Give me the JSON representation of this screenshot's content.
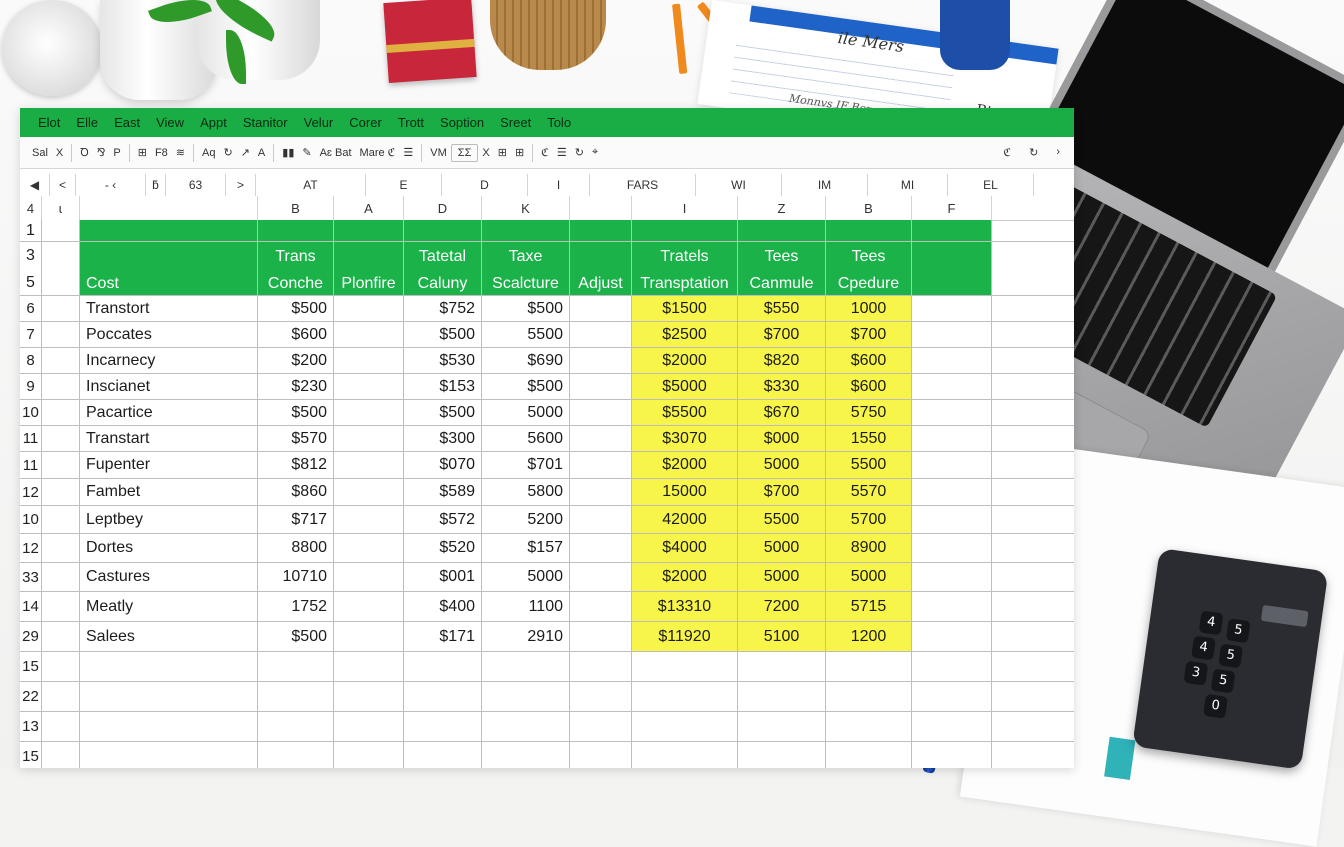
{
  "scene": {
    "paper_title": "ile Mers",
    "paper_sub": "Rtatel",
    "paper_note": "Monnvs IF Bcz"
  },
  "menu": [
    "Elot",
    "Elle",
    "East",
    "View",
    "Appt",
    "Stanitor",
    "Velur",
    "Corer",
    "Trott",
    "Soption",
    "Sreet",
    "Tolo"
  ],
  "toolbar": {
    "left": [
      "Sal",
      "X",
      "Ꝺ",
      "⅋",
      "P",
      "⊞",
      "F8",
      "≋",
      "Aq",
      "↻",
      "↗",
      "A",
      "▮▮",
      "✎",
      "Aɛ  Bat",
      "Mare  ℭ",
      "☰",
      "VM",
      "ƩƩ",
      "X",
      "⊞",
      "⊞",
      "ℭ",
      "☰",
      "↻",
      "⌖"
    ],
    "right": [
      "ℭ",
      "↻",
      "›"
    ]
  },
  "formula_bar": {
    "cells": [
      "◀",
      "<",
      "-  ‹",
      "ƃ",
      "63",
      ">",
      "AT",
      "E",
      "D",
      "I",
      "FARS",
      "WI",
      "IM",
      "MI",
      "EL"
    ]
  },
  "column_letters": [
    "4",
    "ɩ",
    "",
    "B",
    "A",
    "D",
    "K",
    "",
    "I",
    "Z",
    "B",
    "F"
  ],
  "colors": {
    "header_green": "#1bb24a",
    "menu_green": "#1aad46",
    "highlight_yellow": "#f8f54a"
  },
  "header": {
    "row_numbers": [
      "1",
      "3",
      "5"
    ],
    "top": [
      "",
      "",
      "Trans",
      "",
      "Tatetal",
      "Taxe",
      "",
      "Tratels",
      "Tees",
      "Tees",
      ""
    ],
    "bottom": [
      "",
      "Cost",
      "Conche",
      "Plonfire",
      "Caluny",
      "Scalcture",
      "Adjust",
      "Transptation",
      "Canmule",
      "Cpedure",
      ""
    ]
  },
  "rows": [
    {
      "rn": "6",
      "label": "Transtort",
      "c": [
        "$500",
        "",
        "$752",
        "$500",
        "",
        "$1500",
        "$550",
        "1000"
      ]
    },
    {
      "rn": "7",
      "label": "Poccates",
      "c": [
        "$600",
        "",
        "$500",
        "5500",
        "",
        "$2500",
        "$700",
        "$700"
      ]
    },
    {
      "rn": "8",
      "label": "Incarnecy",
      "c": [
        "$200",
        "",
        "$530",
        "$690",
        "",
        "$2000",
        "$820",
        "$600"
      ]
    },
    {
      "rn": "9",
      "label": "Inscianet",
      "c": [
        "$230",
        "",
        "$153",
        "$500",
        "",
        "$5000",
        "$330",
        "$600"
      ]
    },
    {
      "rn": "10",
      "label": "Pacartice",
      "c": [
        "$500",
        "",
        "$500",
        "5000",
        "",
        "$5500",
        "$670",
        "5750"
      ]
    },
    {
      "rn": "11",
      "label": "Transtart",
      "c": [
        "$570",
        "",
        "$300",
        "5600",
        "",
        "$3070",
        "$000",
        "1550"
      ]
    },
    {
      "rn": "11",
      "label": "Fupenter",
      "c": [
        "$812",
        "",
        "$070",
        "$701",
        "",
        "$2000",
        "5000",
        "5500"
      ]
    },
    {
      "rn": "12",
      "label": "Fambet",
      "c": [
        "$860",
        "",
        "$589",
        "5800",
        "",
        "15000",
        "$700",
        "5570"
      ]
    },
    {
      "rn": "10",
      "label": "Leptbey",
      "c": [
        "$717",
        "",
        "$572",
        "5200",
        "",
        "42000",
        "5500",
        "5700"
      ]
    },
    {
      "rn": "12",
      "label": "Dortes",
      "c": [
        "8800",
        "",
        "$520",
        "$157",
        "",
        "$4000",
        "5000",
        "8900"
      ]
    },
    {
      "rn": "33",
      "label": "Castures",
      "c": [
        "10710",
        "",
        "$001",
        "5000",
        "",
        "$2000",
        "5000",
        "5000"
      ]
    },
    {
      "rn": "14",
      "label": "Meatly",
      "c": [
        "1752",
        "",
        "$400",
        "1100",
        "",
        "$13310",
        "7200",
        "5715"
      ]
    },
    {
      "rn": "29",
      "label": "Salees",
      "c": [
        "$500",
        "",
        "$171",
        "2910",
        "",
        "$11920",
        "5100",
        "1200"
      ]
    }
  ],
  "empty_rows": [
    "15",
    "22",
    "13",
    "15"
  ],
  "calculator_keys": [
    "4",
    "5",
    "4",
    "5",
    "3",
    "5",
    "0"
  ]
}
